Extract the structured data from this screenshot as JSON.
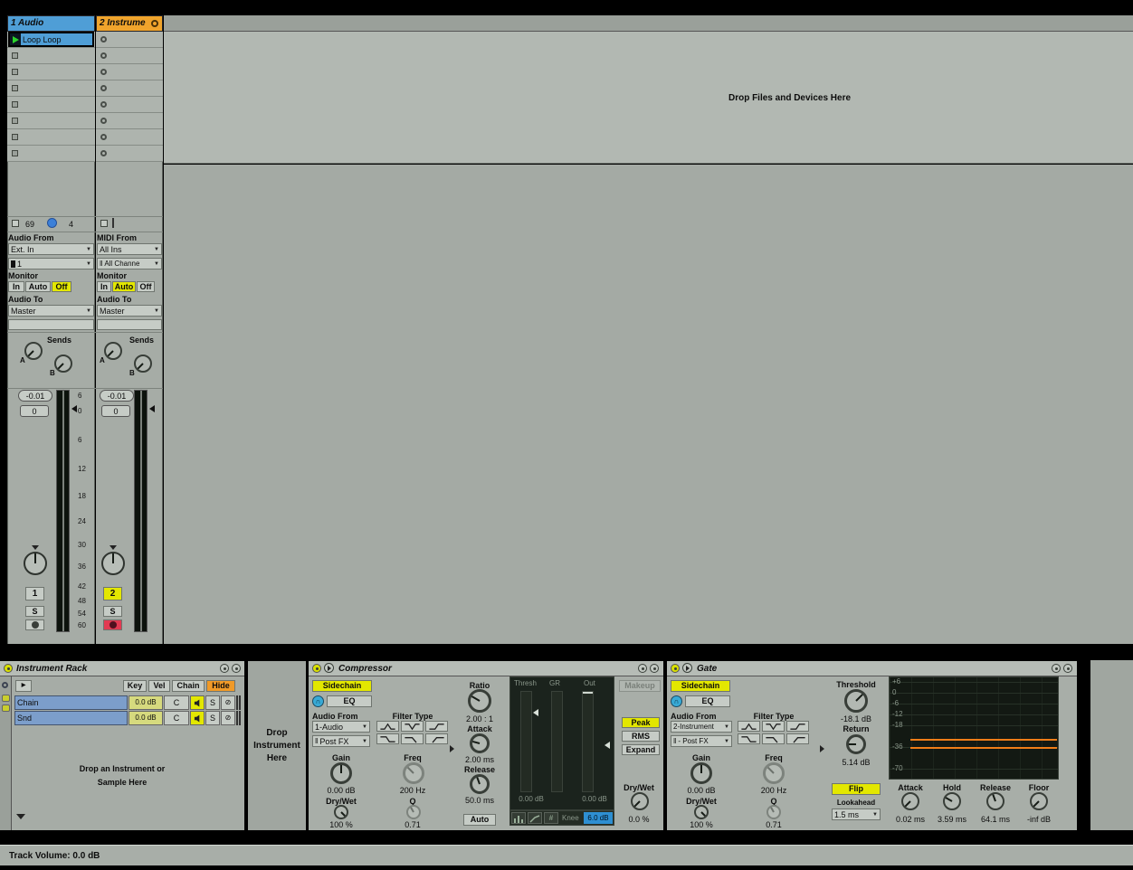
{
  "colors": {
    "track1_header": "#4f9ed6",
    "track2_header": "#f0a42c",
    "active_yellow": "#e3e700",
    "record_red": "#e23a52",
    "clip_blue": "#4f9ed6",
    "play_green": "#2bd32b",
    "knee_highlight": "#2e8fd2",
    "gate_line_orange": "#ef7d18",
    "hide_orange": "#f09a28",
    "chain_row_blue": "#7c9ecb"
  },
  "session": {
    "drop_hint": "Drop Files and Devices Here",
    "meter_scale": [
      "6",
      "0",
      "6",
      "12",
      "18",
      "24",
      "30",
      "36",
      "42",
      "48",
      "54",
      "60"
    ],
    "track1": {
      "title": "1 Audio",
      "clip_label": "Loop Loop",
      "in_num": "69",
      "in_num2": "4",
      "from_label": "Audio From",
      "from_value": "Ext. In",
      "channel_value": "1",
      "monitor_label": "Monitor",
      "monitor_in": "In",
      "monitor_auto": "Auto",
      "monitor_off": "Off",
      "to_label": "Audio To",
      "to_value": "Master",
      "sends_label": "Sends",
      "send_a": "A",
      "send_b": "B",
      "volume": "-0.01",
      "pan": "0",
      "track_no": "1",
      "solo": "S"
    },
    "track2": {
      "title": "2 Instrume",
      "from_label": "MIDI From",
      "from_value": "All Ins",
      "channel_value": "All Channe",
      "monitor_label": "Monitor",
      "monitor_in": "In",
      "monitor_auto": "Auto",
      "monitor_off": "Off",
      "to_label": "Audio To",
      "to_value": "Master",
      "sends_label": "Sends",
      "send_a": "A",
      "send_b": "B",
      "volume": "-0.01",
      "pan": "0",
      "track_no": "2",
      "solo": "S"
    }
  },
  "rack": {
    "title": "Instrument Rack",
    "key": "Key",
    "vel": "Vel",
    "chain": "Chain",
    "hide": "Hide",
    "chains": [
      {
        "name": "Chain",
        "vol": "0.0 dB",
        "pan": "C",
        "solo": "S"
      },
      {
        "name": "Snd",
        "vol": "0.0 dB",
        "pan": "C",
        "solo": "S"
      }
    ],
    "drop_line1": "Drop an Instrument or",
    "drop_line2": "Sample Here",
    "dropzone_line1": "Drop",
    "dropzone_line2": "Instrument",
    "dropzone_line3": "Here"
  },
  "compressor": {
    "title": "Compressor",
    "sidechain": "Sidechain",
    "eq": "EQ",
    "audio_from_label": "Audio From",
    "audio_from": "1-Audio",
    "tap_point": "Post FX",
    "filter_type_label": "Filter Type",
    "gain_label": "Gain",
    "gain": "0.00 dB",
    "freq_label": "Freq",
    "freq": "200 Hz",
    "drywet_label": "Dry/Wet",
    "drywet": "100 %",
    "q_label": "Q",
    "q": "0.71",
    "ratio_label": "Ratio",
    "ratio": "2.00 : 1",
    "attack_label": "Attack",
    "attack": "2.00 ms",
    "release_label": "Release",
    "release": "50.0 ms",
    "auto": "Auto",
    "thresh_label": "Thresh",
    "gr_label": "GR",
    "out_label": "Out",
    "thresh_value": "0.00 dB",
    "out_value": "0.00 dB",
    "makeup": "Makeup",
    "peak": "Peak",
    "rms": "RMS",
    "expand": "Expand",
    "out_drywet_label": "Dry/Wet",
    "out_drywet": "0.0 %",
    "knee_label": "Knee",
    "knee_value": "6.0 dB"
  },
  "gate": {
    "title": "Gate",
    "sidechain": "Sidechain",
    "eq": "EQ",
    "audio_from_label": "Audio From",
    "audio_from": "2-Instrument",
    "tap_point": "- Post FX",
    "filter_type_label": "Filter Type",
    "gain_label": "Gain",
    "gain": "0.00 dB",
    "freq_label": "Freq",
    "freq": "200 Hz",
    "drywet_label": "Dry/Wet",
    "drywet": "100 %",
    "q_label": "Q",
    "q": "0.71",
    "threshold_label": "Threshold",
    "threshold": "-18.1 dB",
    "return_label": "Return",
    "return_value": "5.14 dB",
    "flip": "Flip",
    "lookahead_label": "Lookahead",
    "lookahead": "1.5 ms",
    "scale": [
      "+6",
      "0",
      "-6",
      "-12",
      "-18",
      "-36",
      "-70"
    ],
    "attack_label": "Attack",
    "attack": "0.02 ms",
    "hold_label": "Hold",
    "hold": "3.59 ms",
    "release_label": "Release",
    "release": "64.1 ms",
    "floor_label": "Floor",
    "floor": "-inf dB"
  },
  "status_bar": {
    "text": "Track Volume: 0.0 dB"
  }
}
